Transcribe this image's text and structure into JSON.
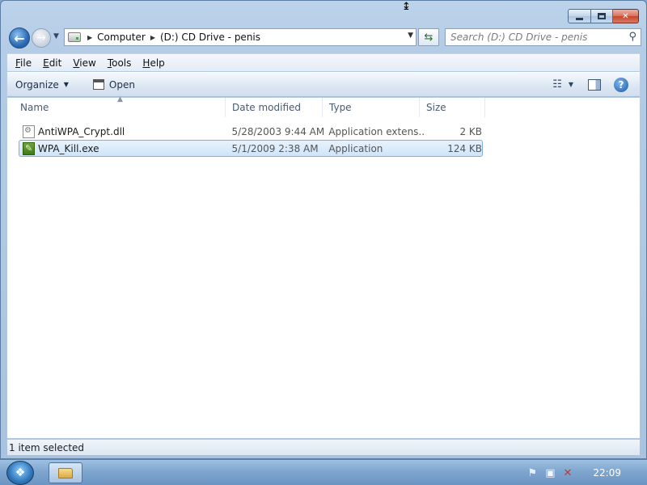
{
  "window": {
    "caption_buttons": {
      "minimize_icon": "minimize-icon",
      "maximize_icon": "maximize-icon",
      "close_icon": "close-icon"
    }
  },
  "nav": {
    "back_icon": "back-arrow-icon",
    "forward_icon": "forward-arrow-icon",
    "breadcrumbs": [
      "Computer",
      "(D:) CD Drive - penis"
    ],
    "search_placeholder": "Search (D:) CD Drive - penis"
  },
  "menu": {
    "items": [
      "File",
      "Edit",
      "View",
      "Tools",
      "Help"
    ],
    "accel": [
      "F",
      "E",
      "V",
      "T",
      "H"
    ]
  },
  "toolbar": {
    "organize_label": "Organize",
    "open_label": "Open"
  },
  "columns": [
    "Name",
    "Date modified",
    "Type",
    "Size"
  ],
  "files": [
    {
      "name": "AntiWPA_Crypt.dll",
      "date": "5/28/2003 9:44 AM",
      "type": "Application extens...",
      "size": "2 KB",
      "icon": "dll-file-icon",
      "selected": false
    },
    {
      "name": "WPA_Kill.exe",
      "date": "5/1/2009 2:38 AM",
      "type": "Application",
      "size": "124 KB",
      "icon": "exe-file-icon",
      "selected": true
    }
  ],
  "status": {
    "text": "1 item selected"
  },
  "taskbar": {
    "clock": "22:09"
  },
  "colors": {
    "selection_bg": "#cfe5fa",
    "selection_border": "#84acdd",
    "taskbar": "#7ea6cf"
  }
}
